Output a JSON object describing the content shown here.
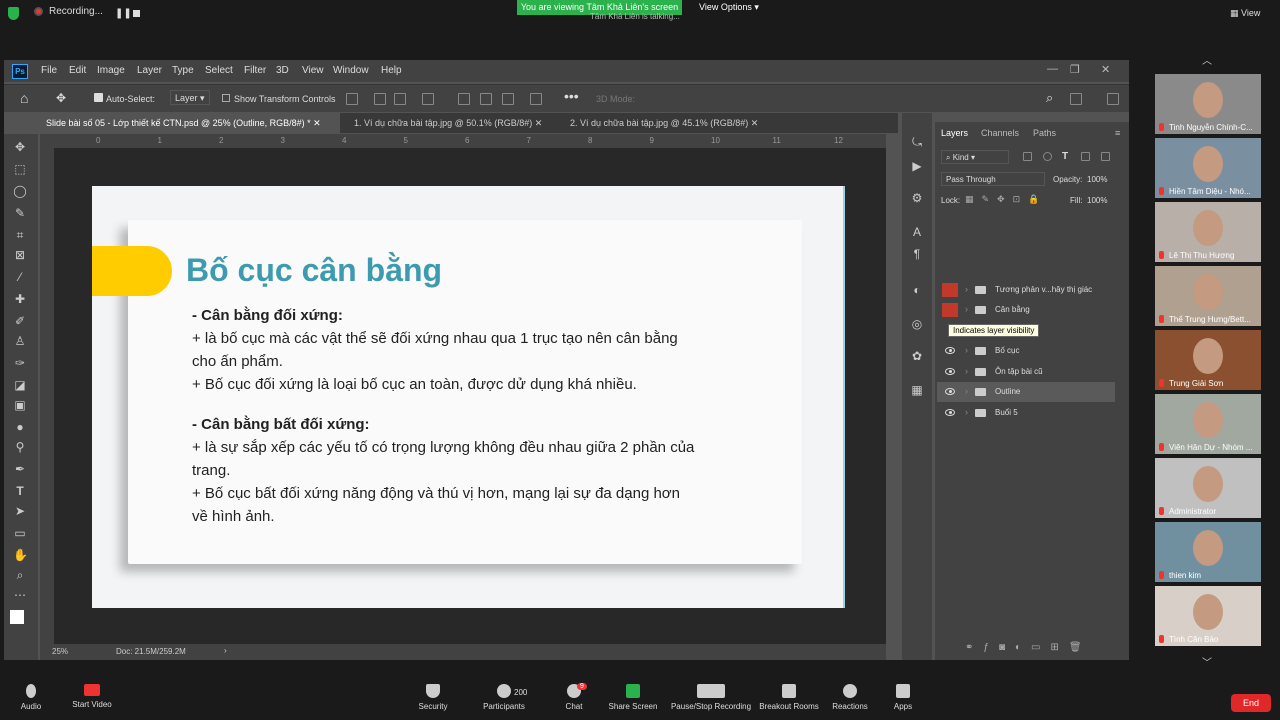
{
  "zoom_top": {
    "recording": "Recording...",
    "viewing_banner": "You are viewing Tâm Khả Liên's screen",
    "talking": "Tâm Khả Liên is talking...",
    "view_options": "View Options",
    "view_label": "View"
  },
  "ps": {
    "menu": [
      "File",
      "Edit",
      "Image",
      "Layer",
      "Type",
      "Select",
      "Filter",
      "3D",
      "View",
      "Window",
      "Help"
    ],
    "options": {
      "auto_select": "Auto-Select:",
      "layer_dropdown": "Layer",
      "show_transform": "Show Transform Controls",
      "mode_3d": "3D Mode:"
    },
    "tabs": [
      "Slide bài số 05 - Lớp thiết kế CTN.psd @ 25% (Outline, RGB/8#) *",
      "1. Ví dụ chữa bài tập.jpg @ 50.1% (RGB/8#)",
      "2. Ví dụ chữa bài tập.jpg @ 45.1% (RGB/8#)"
    ],
    "ruler_ticks": [
      "0",
      "1",
      "2",
      "3",
      "4",
      "5",
      "6",
      "7",
      "8",
      "9",
      "10",
      "11",
      "12"
    ],
    "status_zoom": "25%",
    "status_doc": "Doc: 21.5M/259.2M",
    "slide": {
      "title": "Bố cục cân bằng",
      "lines": [
        "- Cân bằng đối xứng:",
        "+ là bố cục mà các vật thể sẽ đối xứng nhau qua 1 trục tạo nên cân bằng",
        "cho ấn phẩm.",
        "+ Bố cục đối xứng là loại bố cục an toàn, được dử dụng khá nhiều.",
        "- Cân bằng bất đối xứng:",
        "+ là sự sắp xếp các yếu tố có trọng lượng không đều nhau giữa 2 phần của",
        "trang.",
        "+ Bố cục bất đối xứng năng động và thú vị hơn, mạng lại sự đa dạng hơn",
        "về hình ảnh."
      ]
    },
    "layers_panel": {
      "tabs": [
        "Layers",
        "Channels",
        "Paths"
      ],
      "kind": "Kind",
      "blend_mode": "Pass Through",
      "opacity_label": "Opacity:",
      "opacity_value": "100%",
      "lock_label": "Lock:",
      "fill_label": "Fill:",
      "fill_value": "100%",
      "layers": [
        "Tương phản v...hây thị giác",
        "Cân bằng",
        "",
        "Bố cục",
        "Ôn tập bài cũ",
        "Outline",
        "Buổi 5"
      ],
      "tooltip": "Indicates layer visibility"
    }
  },
  "participants": [
    "Tinh Nguyễn Chính-C...",
    "Hiền Tâm Diệu - Nhó...",
    "Lê Thị Thu Hương",
    "Thế Trung Hưng/Bett...",
    "Trung Giải Sơn",
    "Viên Hân Dự - Nhóm ...",
    "Administrator",
    "thien kim",
    "Tình Căn Bảo"
  ],
  "zoom_bottom": {
    "audio": "Audio",
    "video": "Start Video",
    "security": "Security",
    "participants": "Participants",
    "participants_count": "200",
    "chat": "Chat",
    "chat_badge": "9",
    "share": "Share Screen",
    "pause_recording": "Pause/Stop Recording",
    "breakout": "Breakout Rooms",
    "reactions": "Reactions",
    "apps": "Apps",
    "end": "End"
  }
}
